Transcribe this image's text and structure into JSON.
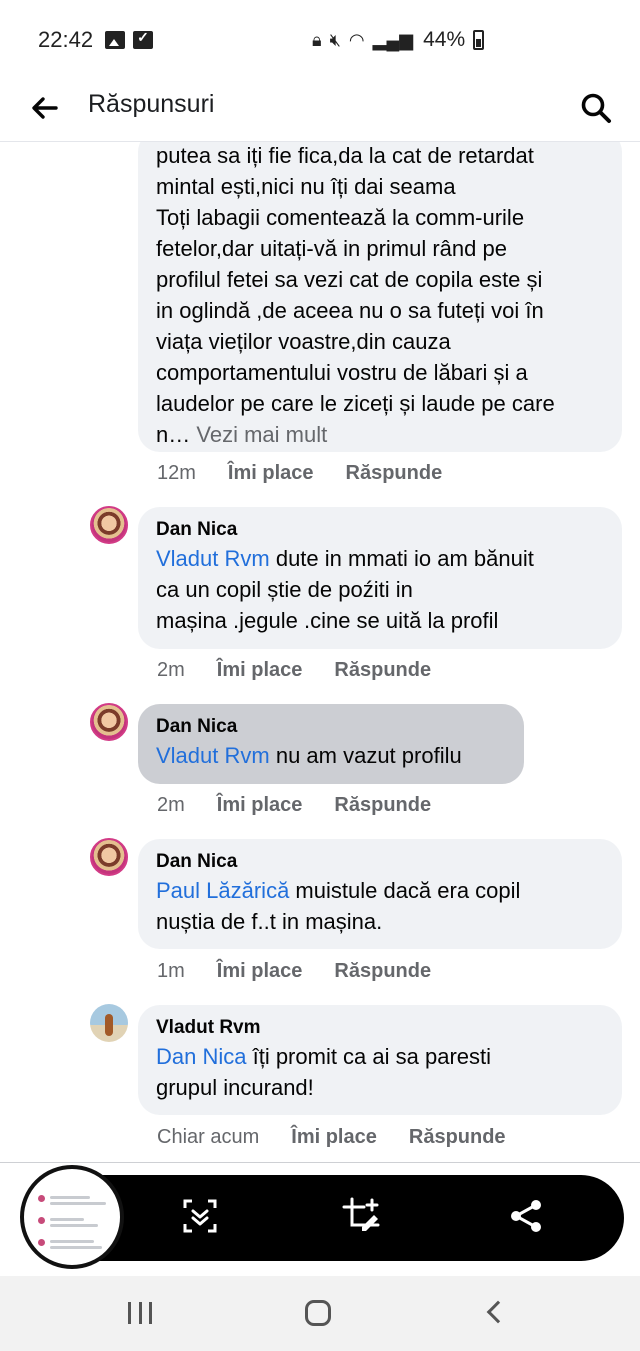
{
  "status_bar": {
    "time": "22:42",
    "battery": "44%"
  },
  "header": {
    "title": "Răspunsuri"
  },
  "comments": [
    {
      "text_lines": "putea sa iți fie fica,da la cat de retardat\nmintal ești,nici nu îți dai seama\nToți labagii comentează la comm-urile\nfetelor,dar uitați-vă in primul rând pe\nprofilul fetei sa vezi cat de copila este și\nin oglindă ,de aceea nu o sa futeți voi în\nviața vieților voastre,din cauza\ncomportamentului vostru de lăbari și a\nlaudelor pe care le ziceți și laude pe care\nn…",
      "see_more": "Vezi mai mult",
      "time": "12m",
      "like": "Îmi place",
      "reply": "Răspunde"
    },
    {
      "author": "Dan Nica",
      "mention": "Vladut Rvm",
      "text": " dute in mmati io am bănuit\nca un copil știe de poźiti in\nmașina .jegule .cine se uită la profil",
      "time": "2m",
      "like": "Îmi place",
      "reply": "Răspunde"
    },
    {
      "author": "Dan Nica",
      "mention": "Vladut Rvm",
      "text": " nu am vazut profilu",
      "time": "2m",
      "like": "Îmi place",
      "reply": "Răspunde"
    },
    {
      "author": "Dan Nica",
      "mention": "Paul Lăzărică",
      "text": " muistule dacă era copil\nnuștia de f..t in mașina.",
      "time": "1m",
      "like": "Îmi place",
      "reply": "Răspunde"
    },
    {
      "author": "Vladut Rvm",
      "mention": "Dan Nica",
      "text": " îți promit ca ai sa paresti\ngrupul incurand!",
      "time": "Chiar acum",
      "like": "Îmi place",
      "reply": "Răspunde"
    }
  ],
  "colors": {
    "mention": "#216fdb",
    "bubble": "#f0f2f5",
    "bubble_selected": "#ccced3",
    "meta": "#65676b"
  },
  "icons": {
    "back": "arrow-left-icon",
    "search": "search-icon",
    "scroll_capture": "scroll-capture-icon",
    "crop_edit": "crop-edit-icon",
    "share": "share-icon"
  }
}
